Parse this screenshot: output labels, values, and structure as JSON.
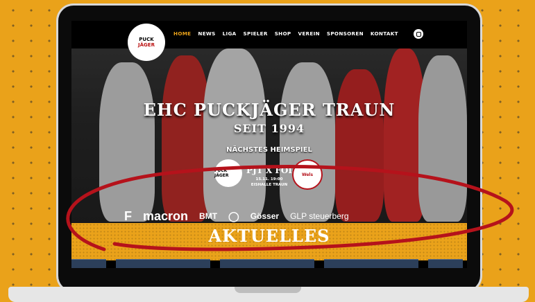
{
  "nav": {
    "logo_line1": "PUCK",
    "logo_line2": "JÄGER",
    "items": [
      "HOME",
      "NEWS",
      "LIGA",
      "SPIELER",
      "SHOP",
      "VEREIN",
      "SPONSOREN",
      "KONTAKT"
    ],
    "active": "HOME",
    "instagram_icon": "instagram-icon"
  },
  "hero": {
    "title": "EHC PUCKJÄGER TRAUN",
    "subtitle": "SEIT 1994",
    "next_game_label": "NÄCHSTES HEIMSPIEL",
    "matchup": "PJT X FOI",
    "datetime": "15.11. 19:00",
    "venue": "EISHALLE TRAUN",
    "home_logo": "PUCK JÄGER",
    "away_logo": "Wels"
  },
  "sponsors": [
    "F",
    "macron",
    "BMT",
    "◯",
    "Gösser",
    "GLP steuerberg"
  ],
  "section": {
    "title": "AKTUELLES"
  },
  "colors": {
    "brand_yellow": "#eaa21a",
    "annotation_red": "#b5121b",
    "active_nav": "#eaa21a"
  }
}
